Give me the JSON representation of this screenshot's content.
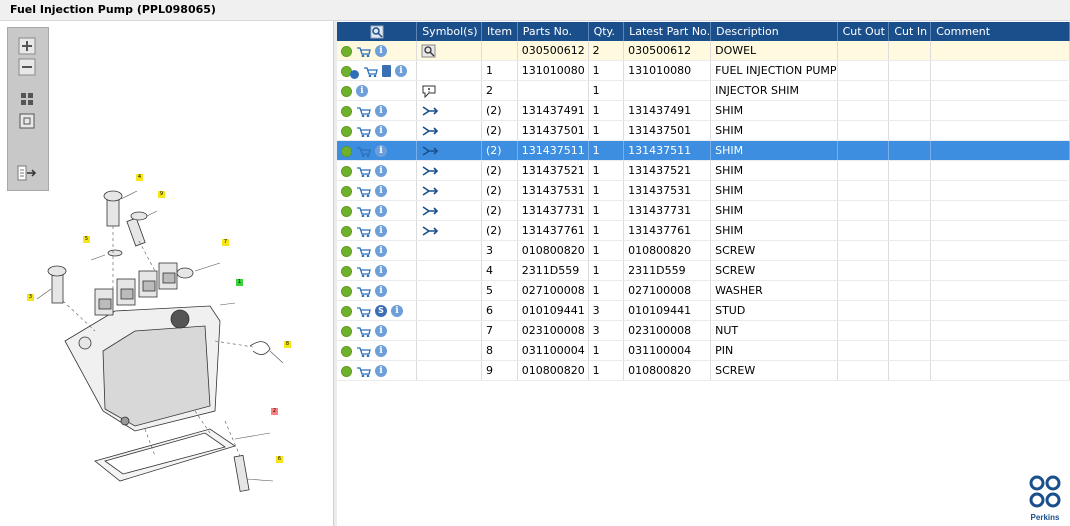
{
  "window": {
    "title": "Fuel Injection Pump (PPL098065)"
  },
  "toolbar": {
    "zoom_in_icon": "zoom-in-icon",
    "zoom_out_icon": "zoom-out-icon",
    "fit_icon": "fit-all-icon",
    "actual_size_icon": "actual-size-icon",
    "export_icon": "export-icon"
  },
  "diagram": {
    "callouts": [
      "4",
      "9",
      "5",
      "7",
      "3",
      "1",
      "8",
      "2",
      "6"
    ]
  },
  "table": {
    "columns": [
      "",
      "Symbol(s)",
      "Item",
      "Parts No.",
      "Qty.",
      "Latest Part No.",
      "Description",
      "Cut Out",
      "Cut In",
      "Comment"
    ],
    "rows": [
      {
        "icons": [
          "gear",
          "cart",
          "info"
        ],
        "symbol": "search",
        "item": "",
        "parts_no": "030500612",
        "qty": "2",
        "latest": "030500612",
        "description": "DOWEL",
        "cut_out": "",
        "cut_in": "",
        "comment": ""
      },
      {
        "icons": [
          "gear-blue",
          "cart",
          "book",
          "info"
        ],
        "symbol": "",
        "item": "1",
        "parts_no": "131010080",
        "qty": "1",
        "latest": "131010080",
        "description": "FUEL INJECTION PUMP",
        "cut_out": "",
        "cut_in": "",
        "comment": ""
      },
      {
        "icons": [
          "gear",
          "info"
        ],
        "symbol": "note",
        "item": "2",
        "parts_no": "",
        "qty": "1",
        "latest": "",
        "description": "INJECTOR SHIM",
        "cut_out": "",
        "cut_in": "",
        "comment": ""
      },
      {
        "icons": [
          "gear",
          "cart",
          "info"
        ],
        "symbol": "swap",
        "item": "(2)",
        "parts_no": "131437491",
        "qty": "1",
        "latest": "131437491",
        "description": "SHIM",
        "cut_out": "",
        "cut_in": "",
        "comment": ""
      },
      {
        "icons": [
          "gear",
          "cart",
          "info"
        ],
        "symbol": "swap",
        "item": "(2)",
        "parts_no": "131437501",
        "qty": "1",
        "latest": "131437501",
        "description": "SHIM",
        "cut_out": "",
        "cut_in": "",
        "comment": ""
      },
      {
        "icons": [
          "gear",
          "cart",
          "info"
        ],
        "symbol": "swap",
        "item": "(2)",
        "parts_no": "131437511",
        "qty": "1",
        "latest": "131437511",
        "description": "SHIM",
        "cut_out": "",
        "cut_in": "",
        "comment": ""
      },
      {
        "icons": [
          "gear",
          "cart",
          "info"
        ],
        "symbol": "swap",
        "item": "(2)",
        "parts_no": "131437521",
        "qty": "1",
        "latest": "131437521",
        "description": "SHIM",
        "cut_out": "",
        "cut_in": "",
        "comment": ""
      },
      {
        "icons": [
          "gear",
          "cart",
          "info"
        ],
        "symbol": "swap",
        "item": "(2)",
        "parts_no": "131437531",
        "qty": "1",
        "latest": "131437531",
        "description": "SHIM",
        "cut_out": "",
        "cut_in": "",
        "comment": ""
      },
      {
        "icons": [
          "gear",
          "cart",
          "info"
        ],
        "symbol": "swap",
        "item": "(2)",
        "parts_no": "131437731",
        "qty": "1",
        "latest": "131437731",
        "description": "SHIM",
        "cut_out": "",
        "cut_in": "",
        "comment": ""
      },
      {
        "icons": [
          "gear",
          "cart",
          "info"
        ],
        "symbol": "swap",
        "item": "(2)",
        "parts_no": "131437761",
        "qty": "1",
        "latest": "131437761",
        "description": "SHIM",
        "cut_out": "",
        "cut_in": "",
        "comment": ""
      },
      {
        "icons": [
          "gear",
          "cart",
          "info"
        ],
        "symbol": "",
        "item": "3",
        "parts_no": "010800820",
        "qty": "1",
        "latest": "010800820",
        "description": "SCREW",
        "cut_out": "",
        "cut_in": "",
        "comment": ""
      },
      {
        "icons": [
          "gear",
          "cart",
          "info"
        ],
        "symbol": "",
        "item": "4",
        "parts_no": "2311D559",
        "qty": "1",
        "latest": "2311D559",
        "description": "SCREW",
        "cut_out": "",
        "cut_in": "",
        "comment": ""
      },
      {
        "icons": [
          "gear",
          "cart",
          "info"
        ],
        "symbol": "",
        "item": "5",
        "parts_no": "027100008",
        "qty": "1",
        "latest": "027100008",
        "description": "WASHER",
        "cut_out": "",
        "cut_in": "",
        "comment": ""
      },
      {
        "icons": [
          "gear",
          "cart",
          "s",
          "info"
        ],
        "symbol": "",
        "item": "6",
        "parts_no": "010109441",
        "qty": "3",
        "latest": "010109441",
        "description": "STUD",
        "cut_out": "",
        "cut_in": "",
        "comment": ""
      },
      {
        "icons": [
          "gear",
          "cart",
          "info"
        ],
        "symbol": "",
        "item": "7",
        "parts_no": "023100008",
        "qty": "3",
        "latest": "023100008",
        "description": "NUT",
        "cut_out": "",
        "cut_in": "",
        "comment": ""
      },
      {
        "icons": [
          "gear",
          "cart",
          "info"
        ],
        "symbol": "",
        "item": "8",
        "parts_no": "031100004",
        "qty": "1",
        "latest": "031100004",
        "description": "PIN",
        "cut_out": "",
        "cut_in": "",
        "comment": ""
      },
      {
        "icons": [
          "gear",
          "cart",
          "info"
        ],
        "symbol": "",
        "item": "9",
        "parts_no": "010800820",
        "qty": "1",
        "latest": "010800820",
        "description": "SCREW",
        "cut_out": "",
        "cut_in": "",
        "comment": ""
      }
    ],
    "selected_row_index": 5,
    "highlighted_row_index": 0
  },
  "brand": {
    "name": "Perkins",
    "color": "#1a4f8c"
  },
  "colors": {
    "header": "#1a4f8c",
    "selection": "#3d8ee0",
    "highlight": "#fffadf"
  }
}
